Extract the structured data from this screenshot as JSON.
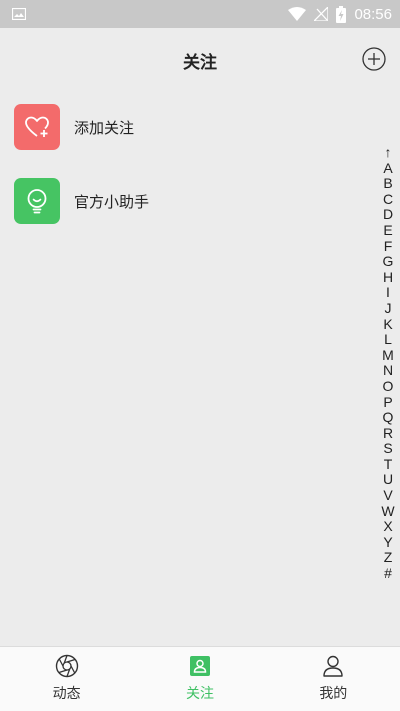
{
  "status_bar": {
    "time": "08:56"
  },
  "header": {
    "title": "关注"
  },
  "list": [
    {
      "label": "添加关注",
      "icon": "heart-plus-icon",
      "color": "#f36b6b"
    },
    {
      "label": "官方小助手",
      "icon": "lightbulb-face-icon",
      "color": "#46c463"
    }
  ],
  "index_letters": [
    "↑",
    "A",
    "B",
    "C",
    "D",
    "E",
    "F",
    "G",
    "H",
    "I",
    "J",
    "K",
    "L",
    "M",
    "N",
    "O",
    "P",
    "Q",
    "R",
    "S",
    "T",
    "U",
    "V",
    "W",
    "X",
    "Y",
    "Z",
    "#"
  ],
  "bottom_nav": [
    {
      "label": "动态",
      "icon": "aperture-icon",
      "active": false
    },
    {
      "label": "关注",
      "icon": "contact-card-icon",
      "active": true
    },
    {
      "label": "我的",
      "icon": "person-icon",
      "active": false
    }
  ],
  "colors": {
    "accent": "#3fc064",
    "status_bar": "#c8c8c8",
    "background": "#ececec"
  }
}
